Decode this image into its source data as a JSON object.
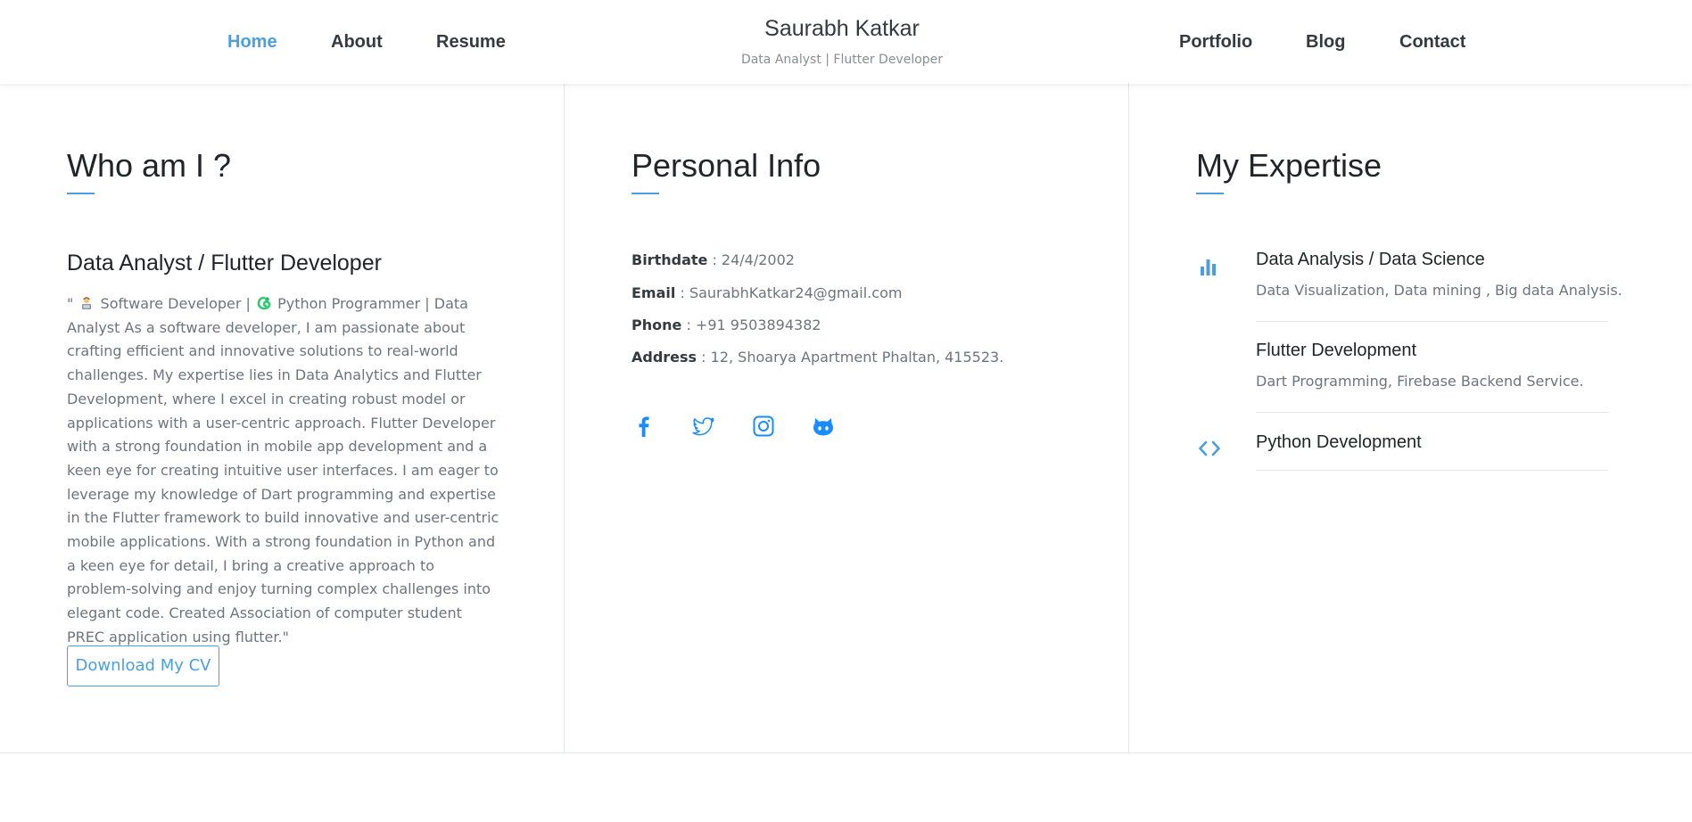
{
  "nav": {
    "home": "Home",
    "about": "About",
    "resume": "Resume",
    "portfolio": "Portfolio",
    "blog": "Blog",
    "contact": "Contact"
  },
  "brand": {
    "name": "Saurabh Katkar",
    "tagline": "Data Analyst | Flutter Developer"
  },
  "who": {
    "title": "Who am I ?",
    "subtitle": "Data Analyst / Flutter Developer",
    "intro_start": "\"",
    "intro_role1": "Software Developer |",
    "intro_role2": "Python Programmer | Data Analyst",
    "bio": "As a software developer, I am passionate about crafting efficient and innovative solutions to real-world challenges. My expertise lies in Data Analytics and Flutter Development, where I excel in creating robust model or applications with a user-centric approach. Flutter Developer with a strong foundation in mobile app development and a keen eye for creating intuitive user interfaces. I am eager to leverage my knowledge of Dart programming and expertise in the Flutter framework to build innovative and user-centric mobile applications. With a strong foundation in Python and a keen eye for detail, I bring a creative approach to problem-solving and enjoy turning complex challenges into elegant code. Created Association of computer student PREC application using flutter.\"",
    "cv_button": "Download My CV"
  },
  "personal": {
    "title": "Personal Info",
    "birthdate_label": "Birthdate",
    "birthdate_value": ": 24/4/2002",
    "email_label": "Email",
    "email_value": ": SaurabhKatkar24@gmail.com",
    "phone_label": "Phone",
    "phone_value": ": +91 9503894382",
    "address_label": "Address",
    "address_value": ": 12, Shoarya Apartment Phaltan, 415523.",
    "social_icons": [
      "facebook-icon",
      "twitter-icon",
      "instagram-icon",
      "github-icon"
    ]
  },
  "expertise": {
    "title": "My Expertise",
    "items": [
      {
        "title": "Data Analysis / Data Science",
        "desc": "Data Visualization, Data mining , Big data Analysis.",
        "icon": "bar-chart-icon"
      },
      {
        "title": "Flutter Development",
        "desc": "Dart Programming, Firebase Backend Service.",
        "icon": ""
      },
      {
        "title": "Python Development",
        "desc": "",
        "icon": "code-icon"
      }
    ]
  },
  "colors": {
    "accent": "#4a9fe0",
    "social": "#1a8cff"
  }
}
